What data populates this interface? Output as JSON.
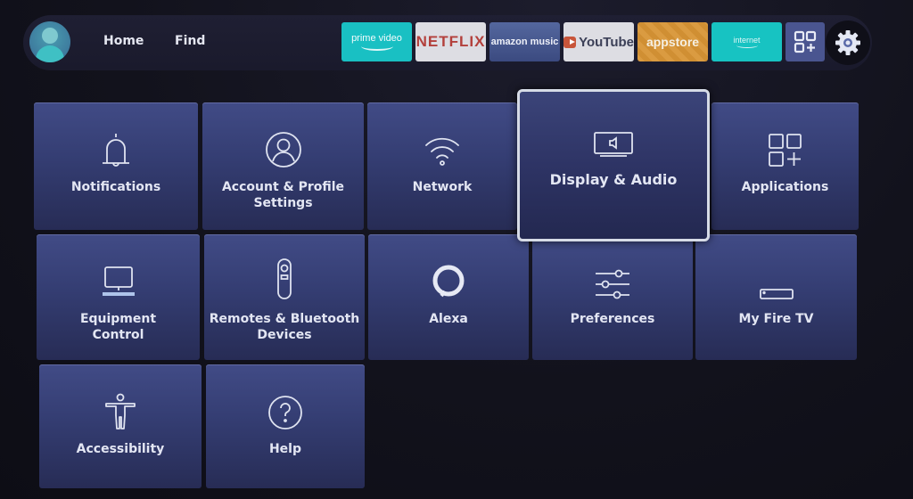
{
  "topbar": {
    "avatar_icon": "user-profile-icon",
    "nav": [
      {
        "label": "Home"
      },
      {
        "label": "Find"
      }
    ],
    "apps": [
      {
        "name": "prime video",
        "label": "prime video",
        "color": "#19c0c3"
      },
      {
        "name": "netflix",
        "label": "NETFLIX",
        "color": "#dddde3"
      },
      {
        "name": "amazon music",
        "label": "amazon music",
        "color": "#4a5b92"
      },
      {
        "name": "youtube",
        "label": "YouTube",
        "color": "#dddde3"
      },
      {
        "name": "appstore",
        "label": "appstore",
        "color": "#d89535"
      },
      {
        "name": "internet",
        "label": "internet",
        "color": "#17c3c2"
      }
    ],
    "apps_button_icon": "apps-grid-plus-icon",
    "settings_icon": "gear-icon"
  },
  "settings": {
    "focused": "Display & Audio",
    "tiles": [
      {
        "label": "Notifications",
        "icon": "bell-icon"
      },
      {
        "label": "Account & Profile\nSettings",
        "icon": "user-circle-icon"
      },
      {
        "label": "Network",
        "icon": "wifi-icon"
      },
      {
        "label": "Display & Audio",
        "icon": "display-audio-icon"
      },
      {
        "label": "Applications",
        "icon": "apps-grid-plus-icon"
      },
      {
        "label": "Equipment\nControl",
        "icon": "tv-equipment-icon"
      },
      {
        "label": "Remotes & Bluetooth\nDevices",
        "icon": "remote-icon"
      },
      {
        "label": "Alexa",
        "icon": "alexa-ring-icon"
      },
      {
        "label": "Preferences",
        "icon": "sliders-icon"
      },
      {
        "label": "My Fire TV",
        "icon": "fire-tv-stick-icon"
      },
      {
        "label": "Accessibility",
        "icon": "accessibility-person-icon"
      },
      {
        "label": "Help",
        "icon": "question-circle-icon"
      }
    ]
  },
  "colors": {
    "background": "#12121c",
    "tile": "#363f76",
    "focus_border": "#d6dbe6",
    "text": "#e3e6f3"
  }
}
